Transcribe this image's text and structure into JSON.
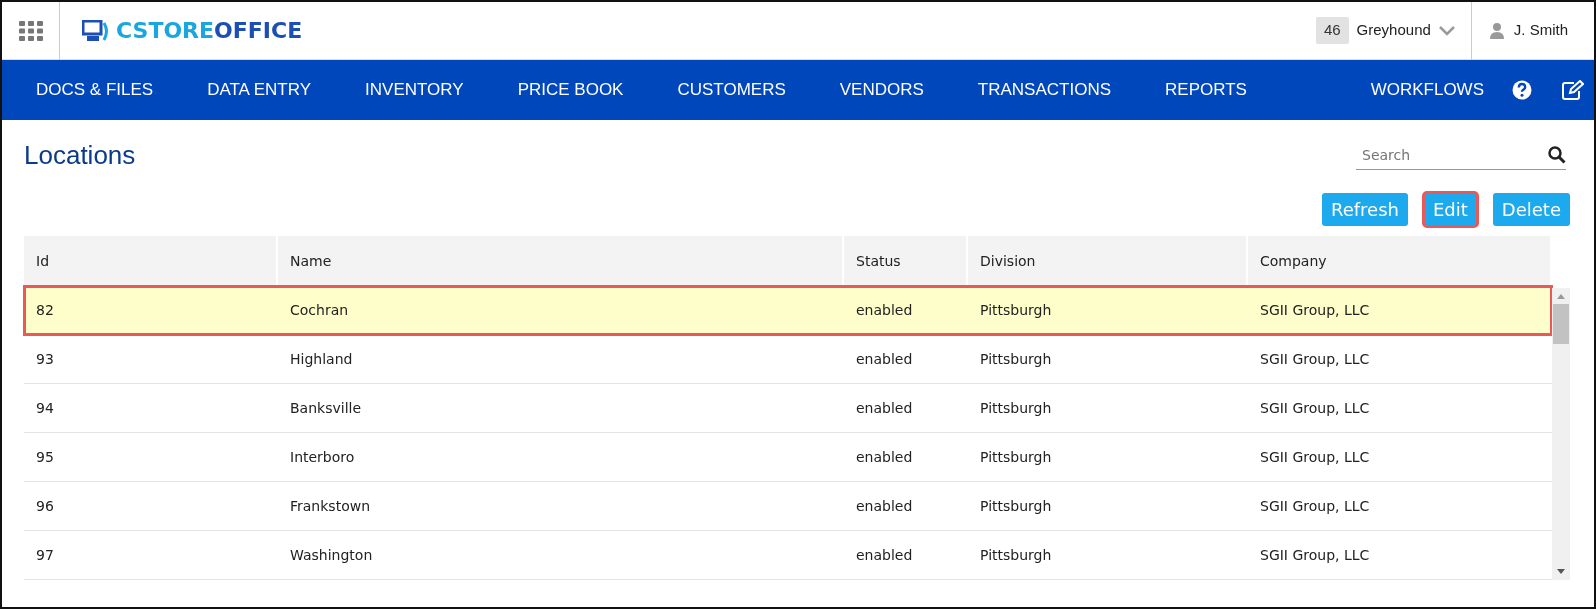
{
  "header": {
    "logo": {
      "part_1": "CSTORE",
      "part_2": "OFFICE"
    },
    "store": {
      "number": "46",
      "name": "Greyhound"
    },
    "user": "J. Smith"
  },
  "nav": [
    "DOCS & FILES",
    "DATA ENTRY",
    "INVENTORY",
    "PRICE BOOK",
    "CUSTOMERS",
    "VENDORS",
    "TRANSACTIONS",
    "REPORTS",
    "WORKFLOWS"
  ],
  "page": {
    "title": "Locations",
    "search": {
      "placeholder": "Search"
    }
  },
  "buttons": [
    {
      "label": "Refresh",
      "highlighted": false
    },
    {
      "label": "Edit",
      "highlighted": true
    },
    {
      "label": "Delete",
      "highlighted": false
    }
  ],
  "table": {
    "columns": [
      "Id",
      "Name",
      "Status",
      "Division",
      "Company"
    ],
    "rows": [
      {
        "cells": [
          "82",
          "Cochran",
          "enabled",
          "Pittsburgh",
          "SGII Group, LLC"
        ],
        "selected": true
      },
      {
        "cells": [
          "93",
          "Highland",
          "enabled",
          "Pittsburgh",
          "SGII Group, LLC"
        ],
        "selected": false
      },
      {
        "cells": [
          "94",
          "Banksville",
          "enabled",
          "Pittsburgh",
          "SGII Group, LLC"
        ],
        "selected": false
      },
      {
        "cells": [
          "95",
          "Interboro",
          "enabled",
          "Pittsburgh",
          "SGII Group, LLC"
        ],
        "selected": false
      },
      {
        "cells": [
          "96",
          "Frankstown",
          "enabled",
          "Pittsburgh",
          "SGII Group, LLC"
        ],
        "selected": false
      },
      {
        "cells": [
          "97",
          "Washington",
          "enabled",
          "Pittsburgh",
          "SGII Group, LLC"
        ],
        "selected": false
      }
    ]
  }
}
